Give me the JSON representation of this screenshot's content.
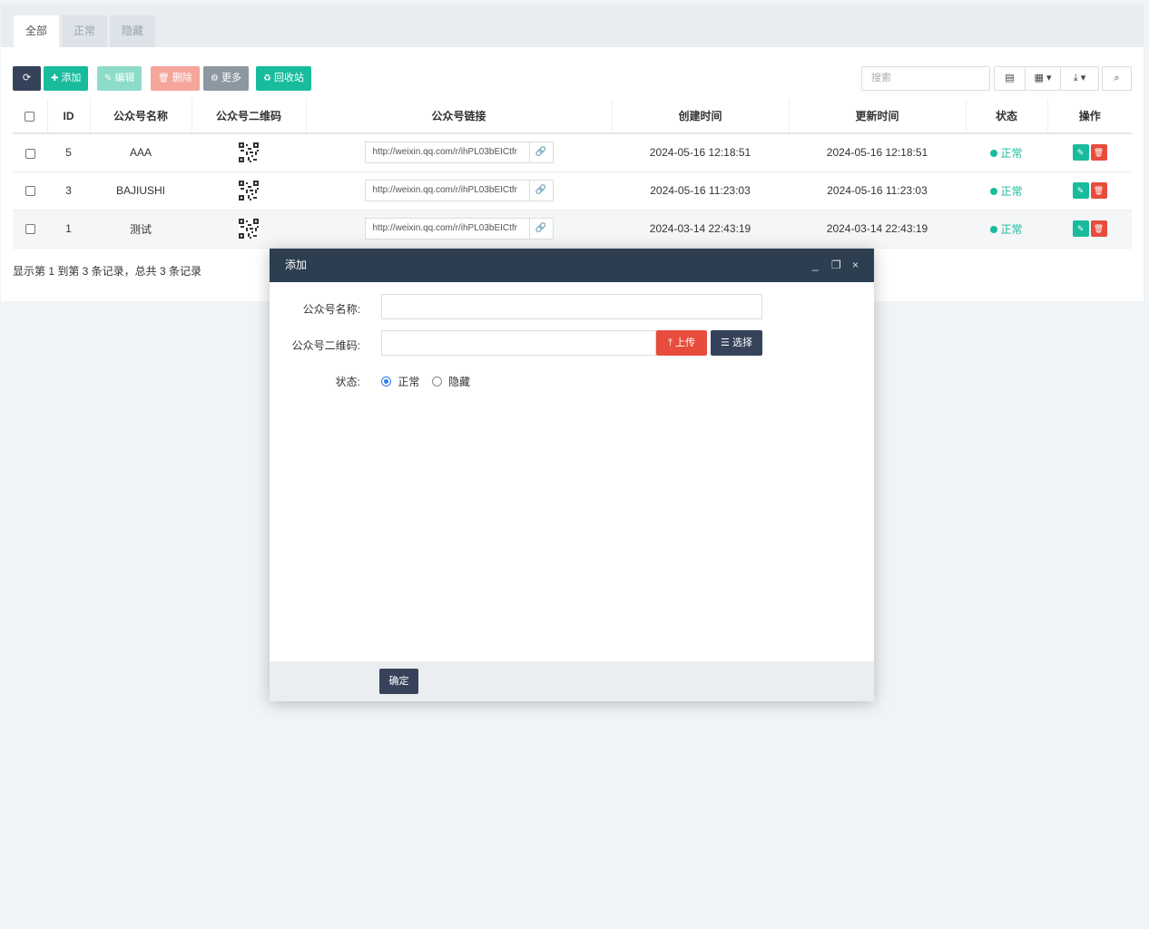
{
  "tabs": [
    {
      "label": "全部"
    },
    {
      "label": "正常"
    },
    {
      "label": "隐藏"
    }
  ],
  "toolbar": {
    "add_label": "添加",
    "edit_label": "编辑",
    "delete_label": "删除",
    "more_label": "更多",
    "recycle_label": "回收站"
  },
  "search": {
    "placeholder": "搜索"
  },
  "table": {
    "headers": {
      "id": "ID",
      "name": "公众号名称",
      "qrcode": "公众号二维码",
      "link": "公众号链接",
      "created": "创建时间",
      "updated": "更新时间",
      "status": "状态",
      "actions": "操作"
    },
    "rows": [
      {
        "id": "5",
        "name": "AAA",
        "link": "http://weixin.qq.com/r/ihPL03bEICtfr",
        "created": "2024-05-16 12:18:51",
        "updated": "2024-05-16 12:18:51",
        "status": "正常"
      },
      {
        "id": "3",
        "name": "BAJIUSHI",
        "link": "http://weixin.qq.com/r/ihPL03bEICtfr",
        "created": "2024-05-16 11:23:03",
        "updated": "2024-05-16 11:23:03",
        "status": "正常"
      },
      {
        "id": "1",
        "name": "测试",
        "link": "http://weixin.qq.com/r/ihPL03bEICtfr",
        "created": "2024-03-14 22:43:19",
        "updated": "2024-03-14 22:43:19",
        "status": "正常"
      }
    ]
  },
  "pager": {
    "text": "显示第 1 到第 3 条记录，总共 3 条记录"
  },
  "modal": {
    "title": "添加",
    "name_label": "公众号名称:",
    "qrcode_label": "公众号二维码:",
    "upload_label": "上传",
    "choose_label": "选择",
    "status_label": "状态:",
    "status_options": [
      "正常",
      "隐藏"
    ],
    "status_selected": "正常",
    "submit_label": "确定"
  },
  "colors": {
    "header_dark": "#2c3e50",
    "success": "#18bc9c",
    "danger": "#e74c3c",
    "primary_dark": "#35425a"
  }
}
